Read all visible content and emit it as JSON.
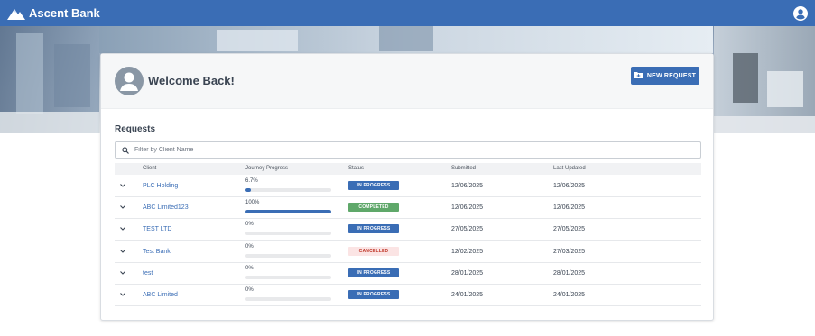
{
  "app": {
    "brand": "Ascent Bank"
  },
  "header": {
    "welcome": "Welcome Back!",
    "new_request_label": "NEW REQUEST"
  },
  "requests": {
    "title": "Requests",
    "filter_placeholder": "Filter by Client Name",
    "columns": {
      "client": "Client",
      "progress": "Journey Progress",
      "status": "Status",
      "submitted": "Submitted",
      "updated": "Last Updated"
    },
    "rows": [
      {
        "client": "PLC Holding",
        "progress_label": "6.7%",
        "progress": 6.7,
        "status": "IN PROGRESS",
        "submitted": "12/06/2025",
        "updated": "12/06/2025"
      },
      {
        "client": "ABC Limited123",
        "progress_label": "100%",
        "progress": 100,
        "status": "COMPLETED",
        "submitted": "12/06/2025",
        "updated": "12/06/2025"
      },
      {
        "client": "TEST LTD",
        "progress_label": "0%",
        "progress": 0,
        "status": "IN PROGRESS",
        "submitted": "27/05/2025",
        "updated": "27/05/2025"
      },
      {
        "client": "Test Bank",
        "progress_label": "0%",
        "progress": 0,
        "status": "CANCELLED",
        "submitted": "12/02/2025",
        "updated": "27/03/2025"
      },
      {
        "client": "test",
        "progress_label": "0%",
        "progress": 0,
        "status": "IN PROGRESS",
        "submitted": "28/01/2025",
        "updated": "28/01/2025"
      },
      {
        "client": "ABC Limited",
        "progress_label": "0%",
        "progress": 0,
        "status": "IN PROGRESS",
        "submitted": "24/01/2025",
        "updated": "24/01/2025"
      }
    ]
  },
  "status_colors": {
    "IN PROGRESS": {
      "bg": "#3a6db5",
      "fg": "#ffffff"
    },
    "COMPLETED": {
      "bg": "#5fa86a",
      "fg": "#ffffff"
    },
    "CANCELLED": {
      "bg": "#fbe4e4",
      "fg": "#c0392b"
    }
  },
  "icons": {
    "brand": "mountain-logo-icon",
    "account": "user-account-icon",
    "new_request": "folder-plus-icon",
    "search": "search-icon",
    "expand": "chevron-down-icon"
  }
}
